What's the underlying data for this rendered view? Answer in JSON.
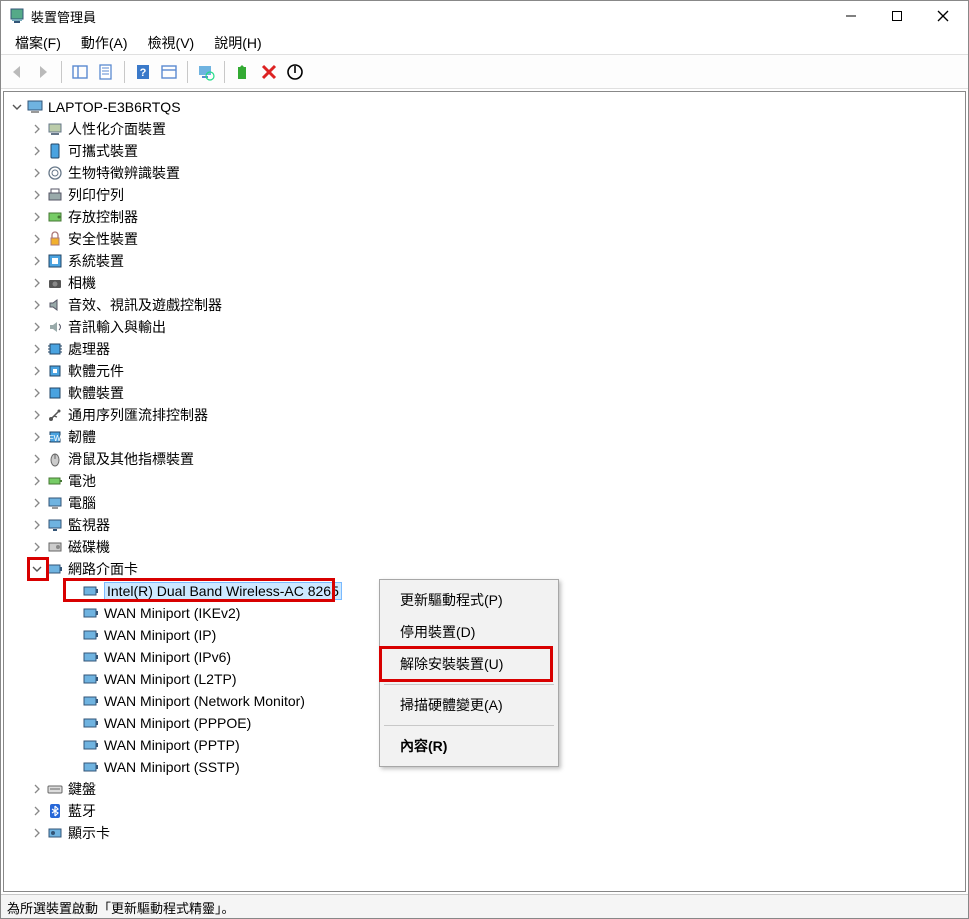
{
  "window": {
    "title": "裝置管理員"
  },
  "menus": {
    "file": "檔案(F)",
    "action": "動作(A)",
    "view": "檢視(V)",
    "help": "說明(H)"
  },
  "tree": {
    "root": "LAPTOP-E3B6RTQS",
    "categories": [
      "人性化介面裝置",
      "可攜式裝置",
      "生物特徵辨識裝置",
      "列印佇列",
      "存放控制器",
      "安全性裝置",
      "系統裝置",
      "相機",
      "音效、視訊及遊戲控制器",
      "音訊輸入與輸出",
      "處理器",
      "軟體元件",
      "軟體裝置",
      "通用序列匯流排控制器",
      "韌體",
      "滑鼠及其他指標裝置",
      "電池",
      "電腦",
      "監視器",
      "磁碟機"
    ],
    "network_category": "網路介面卡",
    "network_children": [
      "Intel(R) Dual Band Wireless-AC 8265",
      "WAN Miniport (IKEv2)",
      "WAN Miniport (IP)",
      "WAN Miniport (IPv6)",
      "WAN Miniport (L2TP)",
      "WAN Miniport (Network Monitor)",
      "WAN Miniport (PPPOE)",
      "WAN Miniport (PPTP)",
      "WAN Miniport (SSTP)"
    ],
    "after_network": [
      "鍵盤",
      "藍牙",
      "顯示卡"
    ]
  },
  "context_menu": {
    "update_driver": "更新驅動程式(P)",
    "disable": "停用裝置(D)",
    "uninstall": "解除安裝裝置(U)",
    "scan": "掃描硬體變更(A)",
    "properties": "內容(R)"
  },
  "status": "為所選裝置啟動「更新驅動程式精靈」。"
}
